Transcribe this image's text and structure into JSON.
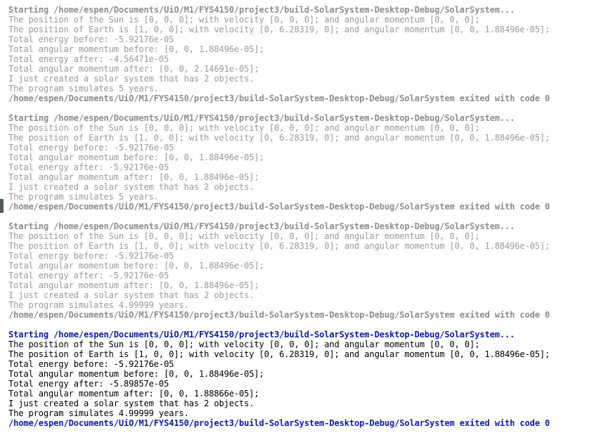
{
  "application_output": {
    "runs": [
      {
        "start_line": "Starting /home/espen/Documents/UiO/M1/FYS4150/project3/build-SolarSystem-Desktop-Debug/SolarSystem...",
        "lines": [
          "The position of the Sun is [0, 0, 0]; with velocity [0, 0, 0]; and angular momentum [0, 0, 0];",
          "The position of Earth is [1, 0, 0]; with velocity [0, 6.28319, 0]; and angular momentum [0, 0, 1.88496e-05];",
          "Total energy before: -5.92176e-05",
          "Total angular momentum before: [0, 0, 1.88496e-05];",
          "Total energy after: -4.56471e-05",
          "Total angular momentum after: [0, 0, 2.14691e-05];",
          "I just created a solar system that has 2 objects.",
          "The program simulates 5 years."
        ],
        "exit_line": "/home/espen/Documents/UiO/M1/FYS4150/project3/build-SolarSystem-Desktop-Debug/SolarSystem exited with code 0"
      },
      {
        "start_line": "Starting /home/espen/Documents/UiO/M1/FYS4150/project3/build-SolarSystem-Desktop-Debug/SolarSystem...",
        "lines": [
          "The position of the Sun is [0, 0, 0]; with velocity [0, 0, 0]; and angular momentum [0, 0, 0];",
          "The position of Earth is [1, 0, 0]; with velocity [0, 6.28319, 0]; and angular momentum [0, 0, 1.88496e-05];",
          "Total energy before: -5.92176e-05",
          "Total angular momentum before: [0, 0, 1.88496e-05];",
          "Total energy after: -5.92176e-05",
          "Total angular momentum after: [0, 0, 1.88496e-05];",
          "I just created a solar system that has 2 objects.",
          "The program simulates 5 years."
        ],
        "exit_line": "/home/espen/Documents/UiO/M1/FYS4150/project3/build-SolarSystem-Desktop-Debug/SolarSystem exited with code 0"
      },
      {
        "start_line": "Starting /home/espen/Documents/UiO/M1/FYS4150/project3/build-SolarSystem-Desktop-Debug/SolarSystem...",
        "lines": [
          "The position of the Sun is [0, 0, 0]; with velocity [0, 0, 0]; and angular momentum [0, 0, 0];",
          "The position of Earth is [1, 0, 0]; with velocity [0, 6.28319, 0]; and angular momentum [0, 0, 1.88496e-05];",
          "Total energy before: -5.92176e-05",
          "Total angular momentum before: [0, 0, 1.88496e-05];",
          "Total energy after: -5.92176e-05",
          "Total angular momentum after: [0, 0, 1.88496e-05];",
          "I just created a solar system that has 2 objects.",
          "The program simulates 4.99999 years."
        ],
        "exit_line": "/home/espen/Documents/UiO/M1/FYS4150/project3/build-SolarSystem-Desktop-Debug/SolarSystem exited with code 0"
      },
      {
        "start_line": "Starting /home/espen/Documents/UiO/M1/FYS4150/project3/build-SolarSystem-Desktop-Debug/SolarSystem...",
        "lines": [
          "The position of the Sun is [0, 0, 0]; with velocity [0, 0, 0]; and angular momentum [0, 0, 0];",
          "The position of Earth is [1, 0, 0]; with velocity [0, 6.28319, 0]; and angular momentum [0, 0, 1.88496e-05];",
          "Total energy before: -5.92176e-05",
          "Total angular momentum before: [0, 0, 1.88496e-05];",
          "Total energy after: -5.89857e-05",
          "Total angular momentum after: [0, 0, 1.88866e-05];",
          "I just created a solar system that has 2 objects.",
          "The program simulates 4.99999 years."
        ],
        "exit_line": "/home/espen/Documents/UiO/M1/FYS4150/project3/build-SolarSystem-Desktop-Debug/SolarSystem exited with code 0"
      }
    ]
  },
  "colors": {
    "background": "#ffffff",
    "old_run_text": "#9a9a9a",
    "old_run_status": "#8d8d8d",
    "latest_run_text": "#000000",
    "latest_run_status": "#0f1d9c"
  }
}
